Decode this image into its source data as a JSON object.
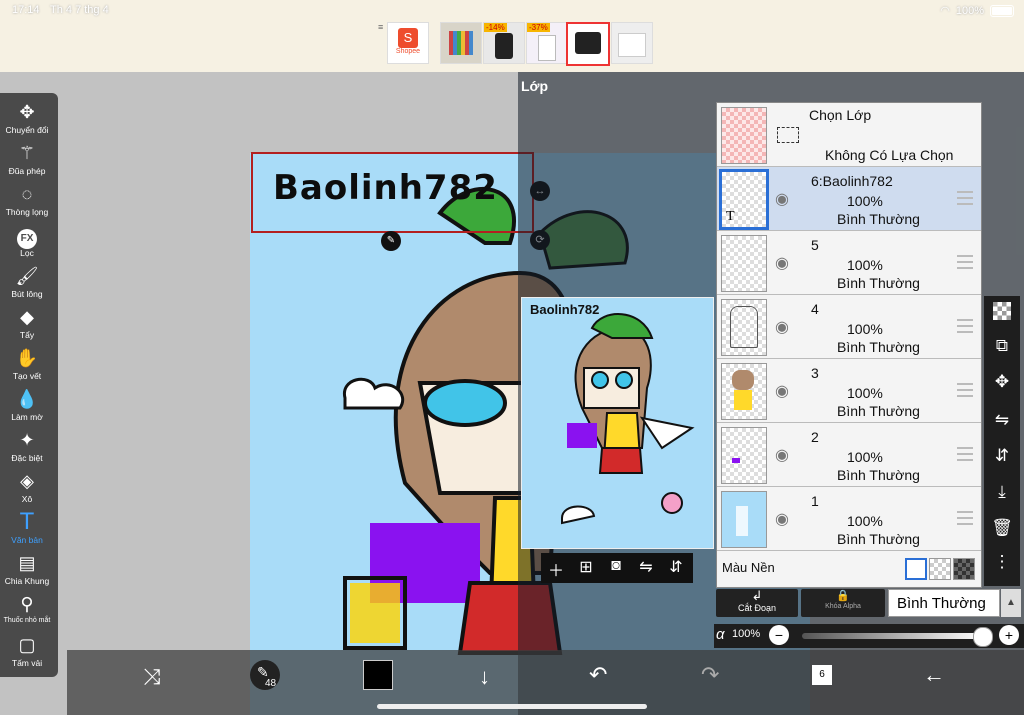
{
  "status_bar": {
    "time": "17:14",
    "date": "Th 4 7 thg 4",
    "battery": "100%"
  },
  "ad": {
    "shopee_label": "Shopee",
    "badges": [
      "-14%",
      "-37%"
    ]
  },
  "canvas": {
    "text_layer_content": "Baolinh782",
    "preview_text": "Baolinh782"
  },
  "toolbar": {
    "tools": [
      {
        "label": "Chuyển đổi",
        "icon": "move-icon"
      },
      {
        "label": "Đũa phép",
        "icon": "magic-wand-icon"
      },
      {
        "label": "Thòng lọng",
        "icon": "lasso-icon"
      },
      {
        "label": "Lọc",
        "icon": "fx-icon"
      },
      {
        "label": "Bút lông",
        "icon": "brush-icon"
      },
      {
        "label": "Tẩy",
        "icon": "eraser-icon"
      },
      {
        "label": "Tạo vết",
        "icon": "smudge-icon"
      },
      {
        "label": "Làm mờ",
        "icon": "blur-icon"
      },
      {
        "label": "Đặc biệt",
        "icon": "special-icon"
      },
      {
        "label": "Xô",
        "icon": "bucket-icon"
      },
      {
        "label": "Văn bản",
        "icon": "text-icon"
      },
      {
        "label": "Chia Khung",
        "icon": "frame-divider-icon"
      },
      {
        "label": "Thuốc nhỏ mắt",
        "icon": "eyedropper-icon"
      },
      {
        "label": "Tấm vải",
        "icon": "canvas-icon"
      }
    ]
  },
  "layers": {
    "title": "Lớp",
    "selection_row": {
      "title": "Chọn Lớp",
      "subtitle": "Không Có Lựa Chọn"
    },
    "items": [
      {
        "name": "6:Baolinh782",
        "opacity": "100%",
        "mode": "Bình Thường",
        "selected": true
      },
      {
        "name": "5",
        "opacity": "100%",
        "mode": "Bình Thường",
        "selected": false
      },
      {
        "name": "4",
        "opacity": "100%",
        "mode": "Bình Thường",
        "selected": false
      },
      {
        "name": "3",
        "opacity": "100%",
        "mode": "Bình Thường",
        "selected": false
      },
      {
        "name": "2",
        "opacity": "100%",
        "mode": "Bình Thường",
        "selected": false
      },
      {
        "name": "1",
        "opacity": "100%",
        "mode": "Bình Thường",
        "selected": false
      }
    ],
    "background_label": "Màu Nền",
    "clip_label": "Cắt Đoạn",
    "alpha_lock_label": "Khóa Alpha",
    "blend_mode": "Bình Thường",
    "alpha_symbol": "α",
    "alpha_value": "100%",
    "opacity_fraction": 1.0
  },
  "bottom_bar": {
    "brush_size": "48",
    "layer_count": "6"
  },
  "colors": {
    "accent": "#2a6fd6",
    "toolbar_bg": "#4a4a4a",
    "active_tool": "#3ea0ff",
    "primary_color": "#000000"
  }
}
